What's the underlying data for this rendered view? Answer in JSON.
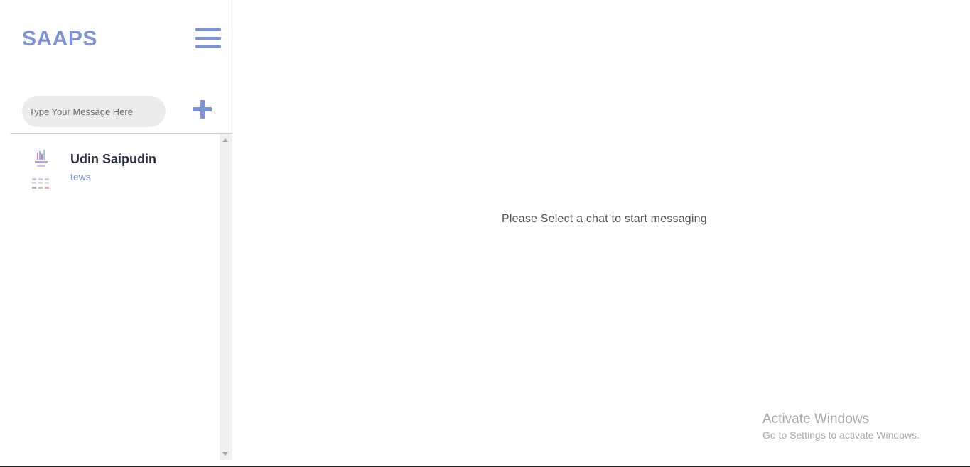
{
  "app": {
    "brand": "SAAPS"
  },
  "sidebar": {
    "search_placeholder": "Type Your Message Here",
    "menu_icon": "hamburger-menu-icon",
    "add_icon": "plus-icon",
    "chats": [
      {
        "name": "Udin Saipudin",
        "preview": "tews"
      }
    ]
  },
  "main": {
    "empty_message": "Please Select a chat to start messaging"
  },
  "watermark": {
    "title": "Activate Windows",
    "subtitle": "Go to Settings to activate Windows."
  },
  "colors": {
    "accent": "#7d93d6",
    "text_dark": "#2b3340",
    "input_bg": "#ececec"
  }
}
